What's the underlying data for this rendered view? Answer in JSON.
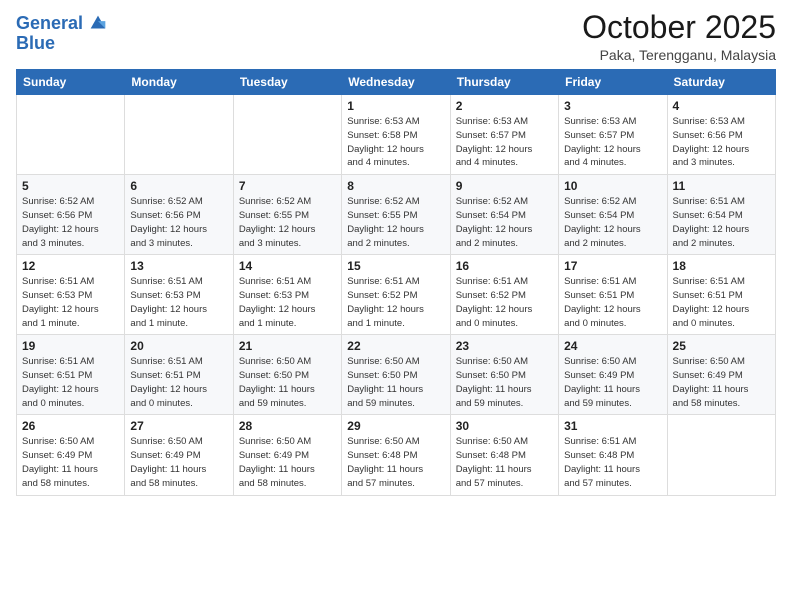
{
  "header": {
    "logo_line1": "General",
    "logo_line2": "Blue",
    "month": "October 2025",
    "location": "Paka, Terengganu, Malaysia"
  },
  "weekdays": [
    "Sunday",
    "Monday",
    "Tuesday",
    "Wednesday",
    "Thursday",
    "Friday",
    "Saturday"
  ],
  "weeks": [
    [
      {
        "day": "",
        "info": ""
      },
      {
        "day": "",
        "info": ""
      },
      {
        "day": "",
        "info": ""
      },
      {
        "day": "1",
        "info": "Sunrise: 6:53 AM\nSunset: 6:58 PM\nDaylight: 12 hours\nand 4 minutes."
      },
      {
        "day": "2",
        "info": "Sunrise: 6:53 AM\nSunset: 6:57 PM\nDaylight: 12 hours\nand 4 minutes."
      },
      {
        "day": "3",
        "info": "Sunrise: 6:53 AM\nSunset: 6:57 PM\nDaylight: 12 hours\nand 4 minutes."
      },
      {
        "day": "4",
        "info": "Sunrise: 6:53 AM\nSunset: 6:56 PM\nDaylight: 12 hours\nand 3 minutes."
      }
    ],
    [
      {
        "day": "5",
        "info": "Sunrise: 6:52 AM\nSunset: 6:56 PM\nDaylight: 12 hours\nand 3 minutes."
      },
      {
        "day": "6",
        "info": "Sunrise: 6:52 AM\nSunset: 6:56 PM\nDaylight: 12 hours\nand 3 minutes."
      },
      {
        "day": "7",
        "info": "Sunrise: 6:52 AM\nSunset: 6:55 PM\nDaylight: 12 hours\nand 3 minutes."
      },
      {
        "day": "8",
        "info": "Sunrise: 6:52 AM\nSunset: 6:55 PM\nDaylight: 12 hours\nand 2 minutes."
      },
      {
        "day": "9",
        "info": "Sunrise: 6:52 AM\nSunset: 6:54 PM\nDaylight: 12 hours\nand 2 minutes."
      },
      {
        "day": "10",
        "info": "Sunrise: 6:52 AM\nSunset: 6:54 PM\nDaylight: 12 hours\nand 2 minutes."
      },
      {
        "day": "11",
        "info": "Sunrise: 6:51 AM\nSunset: 6:54 PM\nDaylight: 12 hours\nand 2 minutes."
      }
    ],
    [
      {
        "day": "12",
        "info": "Sunrise: 6:51 AM\nSunset: 6:53 PM\nDaylight: 12 hours\nand 1 minute."
      },
      {
        "day": "13",
        "info": "Sunrise: 6:51 AM\nSunset: 6:53 PM\nDaylight: 12 hours\nand 1 minute."
      },
      {
        "day": "14",
        "info": "Sunrise: 6:51 AM\nSunset: 6:53 PM\nDaylight: 12 hours\nand 1 minute."
      },
      {
        "day": "15",
        "info": "Sunrise: 6:51 AM\nSunset: 6:52 PM\nDaylight: 12 hours\nand 1 minute."
      },
      {
        "day": "16",
        "info": "Sunrise: 6:51 AM\nSunset: 6:52 PM\nDaylight: 12 hours\nand 0 minutes."
      },
      {
        "day": "17",
        "info": "Sunrise: 6:51 AM\nSunset: 6:51 PM\nDaylight: 12 hours\nand 0 minutes."
      },
      {
        "day": "18",
        "info": "Sunrise: 6:51 AM\nSunset: 6:51 PM\nDaylight: 12 hours\nand 0 minutes."
      }
    ],
    [
      {
        "day": "19",
        "info": "Sunrise: 6:51 AM\nSunset: 6:51 PM\nDaylight: 12 hours\nand 0 minutes."
      },
      {
        "day": "20",
        "info": "Sunrise: 6:51 AM\nSunset: 6:51 PM\nDaylight: 12 hours\nand 0 minutes."
      },
      {
        "day": "21",
        "info": "Sunrise: 6:50 AM\nSunset: 6:50 PM\nDaylight: 11 hours\nand 59 minutes."
      },
      {
        "day": "22",
        "info": "Sunrise: 6:50 AM\nSunset: 6:50 PM\nDaylight: 11 hours\nand 59 minutes."
      },
      {
        "day": "23",
        "info": "Sunrise: 6:50 AM\nSunset: 6:50 PM\nDaylight: 11 hours\nand 59 minutes."
      },
      {
        "day": "24",
        "info": "Sunrise: 6:50 AM\nSunset: 6:49 PM\nDaylight: 11 hours\nand 59 minutes."
      },
      {
        "day": "25",
        "info": "Sunrise: 6:50 AM\nSunset: 6:49 PM\nDaylight: 11 hours\nand 58 minutes."
      }
    ],
    [
      {
        "day": "26",
        "info": "Sunrise: 6:50 AM\nSunset: 6:49 PM\nDaylight: 11 hours\nand 58 minutes."
      },
      {
        "day": "27",
        "info": "Sunrise: 6:50 AM\nSunset: 6:49 PM\nDaylight: 11 hours\nand 58 minutes."
      },
      {
        "day": "28",
        "info": "Sunrise: 6:50 AM\nSunset: 6:49 PM\nDaylight: 11 hours\nand 58 minutes."
      },
      {
        "day": "29",
        "info": "Sunrise: 6:50 AM\nSunset: 6:48 PM\nDaylight: 11 hours\nand 57 minutes."
      },
      {
        "day": "30",
        "info": "Sunrise: 6:50 AM\nSunset: 6:48 PM\nDaylight: 11 hours\nand 57 minutes."
      },
      {
        "day": "31",
        "info": "Sunrise: 6:51 AM\nSunset: 6:48 PM\nDaylight: 11 hours\nand 57 minutes."
      },
      {
        "day": "",
        "info": ""
      }
    ]
  ]
}
